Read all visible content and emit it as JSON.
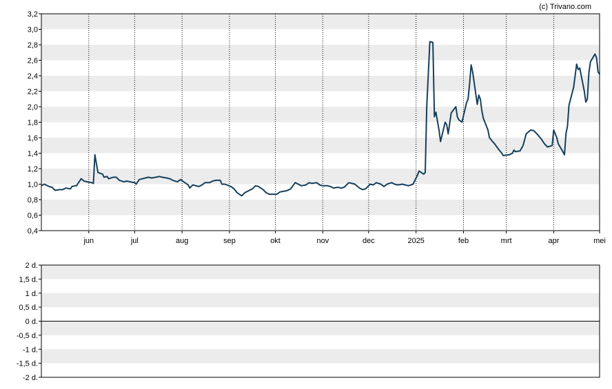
{
  "credit": "(c) Trivano.com",
  "colors": {
    "line": "#143f5c",
    "band": "#ececec",
    "axis": "#000000",
    "vgrid": "#000000",
    "zero": "#000000"
  },
  "chart_data": [
    {
      "type": "line",
      "title": "",
      "xlabel": "",
      "ylabel": "",
      "grid": "alternating horizontal bands, dotted vertical month lines",
      "ylim": [
        0.4,
        3.2
      ],
      "yticks": [
        "0,4",
        "0,6",
        "0,8",
        "1,0",
        "1,2",
        "1,4",
        "1,6",
        "1,8",
        "2,0",
        "2,2",
        "2,4",
        "2,6",
        "2,8",
        "3,0",
        "3,2"
      ],
      "xlim": [
        "2024-05-01",
        "2025-05-01"
      ],
      "xticks": [
        {
          "date": "2024-06-01",
          "label": "jun"
        },
        {
          "date": "2024-07-01",
          "label": "jul"
        },
        {
          "date": "2024-08-01",
          "label": "aug"
        },
        {
          "date": "2024-09-01",
          "label": "sep"
        },
        {
          "date": "2024-10-01",
          "label": "okt"
        },
        {
          "date": "2024-11-01",
          "label": "nov"
        },
        {
          "date": "2024-12-01",
          "label": "dec"
        },
        {
          "date": "2025-01-01",
          "label": "2025"
        },
        {
          "date": "2025-02-01",
          "label": "feb"
        },
        {
          "date": "2025-03-01",
          "label": "mrt"
        },
        {
          "date": "2025-04-01",
          "label": "apr"
        },
        {
          "date": "2025-05-01",
          "label": "mei"
        }
      ],
      "series": [
        {
          "points": [
            [
              "2024-05-01",
              0.98
            ],
            [
              "2024-05-03",
              1.0
            ],
            [
              "2024-05-06",
              0.97
            ],
            [
              "2024-05-08",
              0.96
            ],
            [
              "2024-05-10",
              0.92
            ],
            [
              "2024-05-13",
              0.93
            ],
            [
              "2024-05-15",
              0.93
            ],
            [
              "2024-05-17",
              0.95
            ],
            [
              "2024-05-20",
              0.94
            ],
            [
              "2024-05-21",
              0.97
            ],
            [
              "2024-05-23",
              0.98
            ],
            [
              "2024-05-24",
              0.98
            ],
            [
              "2024-05-27",
              1.07
            ],
            [
              "2024-05-29",
              1.04
            ],
            [
              "2024-05-31",
              1.03
            ],
            [
              "2024-06-03",
              1.02
            ],
            [
              "2024-06-04",
              1.01
            ],
            [
              "2024-06-05",
              1.38
            ],
            [
              "2024-06-07",
              1.15
            ],
            [
              "2024-06-10",
              1.13
            ],
            [
              "2024-06-11",
              1.09
            ],
            [
              "2024-06-13",
              1.1
            ],
            [
              "2024-06-14",
              1.07
            ],
            [
              "2024-06-17",
              1.09
            ],
            [
              "2024-06-19",
              1.09
            ],
            [
              "2024-06-21",
              1.05
            ],
            [
              "2024-06-24",
              1.03
            ],
            [
              "2024-06-26",
              1.04
            ],
            [
              "2024-06-28",
              1.03
            ],
            [
              "2024-07-01",
              1.02
            ],
            [
              "2024-07-02",
              1.0
            ],
            [
              "2024-07-04",
              1.06
            ],
            [
              "2024-07-08",
              1.08
            ],
            [
              "2024-07-10",
              1.09
            ],
            [
              "2024-07-12",
              1.08
            ],
            [
              "2024-07-15",
              1.09
            ],
            [
              "2024-07-17",
              1.1
            ],
            [
              "2024-07-19",
              1.09
            ],
            [
              "2024-07-22",
              1.08
            ],
            [
              "2024-07-24",
              1.07
            ],
            [
              "2024-07-26",
              1.05
            ],
            [
              "2024-07-29",
              1.03
            ],
            [
              "2024-07-31",
              1.06
            ],
            [
              "2024-08-02",
              1.03
            ],
            [
              "2024-08-05",
              0.99
            ],
            [
              "2024-08-06",
              0.95
            ],
            [
              "2024-08-08",
              0.99
            ],
            [
              "2024-08-12",
              0.97
            ],
            [
              "2024-08-14",
              0.99
            ],
            [
              "2024-08-16",
              1.02
            ],
            [
              "2024-08-19",
              1.02
            ],
            [
              "2024-08-21",
              1.04
            ],
            [
              "2024-08-23",
              1.05
            ],
            [
              "2024-08-26",
              1.05
            ],
            [
              "2024-08-27",
              1.0
            ],
            [
              "2024-08-29",
              1.0
            ],
            [
              "2024-09-02",
              0.97
            ],
            [
              "2024-09-04",
              0.94
            ],
            [
              "2024-09-06",
              0.89
            ],
            [
              "2024-09-09",
              0.85
            ],
            [
              "2024-09-11",
              0.89
            ],
            [
              "2024-09-13",
              0.91
            ],
            [
              "2024-09-16",
              0.94
            ],
            [
              "2024-09-18",
              0.98
            ],
            [
              "2024-09-20",
              0.97
            ],
            [
              "2024-09-23",
              0.93
            ],
            [
              "2024-09-25",
              0.89
            ],
            [
              "2024-09-27",
              0.87
            ],
            [
              "2024-09-30",
              0.87
            ],
            [
              "2024-10-02",
              0.87
            ],
            [
              "2024-10-04",
              0.9
            ],
            [
              "2024-10-07",
              0.91
            ],
            [
              "2024-10-09",
              0.92
            ],
            [
              "2024-10-11",
              0.94
            ],
            [
              "2024-10-14",
              1.02
            ],
            [
              "2024-10-16",
              1.0
            ],
            [
              "2024-10-18",
              0.98
            ],
            [
              "2024-10-21",
              0.99
            ],
            [
              "2024-10-23",
              1.02
            ],
            [
              "2024-10-25",
              1.01
            ],
            [
              "2024-10-28",
              1.02
            ],
            [
              "2024-10-30",
              0.99
            ],
            [
              "2024-11-01",
              0.98
            ],
            [
              "2024-11-04",
              0.98
            ],
            [
              "2024-11-06",
              0.97
            ],
            [
              "2024-11-08",
              0.95
            ],
            [
              "2024-11-11",
              0.96
            ],
            [
              "2024-11-13",
              0.95
            ],
            [
              "2024-11-15",
              0.96
            ],
            [
              "2024-11-18",
              1.02
            ],
            [
              "2024-11-20",
              1.01
            ],
            [
              "2024-11-22",
              1.0
            ],
            [
              "2024-11-25",
              0.95
            ],
            [
              "2024-11-27",
              0.93
            ],
            [
              "2024-11-29",
              0.94
            ],
            [
              "2024-12-02",
              1.0
            ],
            [
              "2024-12-04",
              0.99
            ],
            [
              "2024-12-06",
              1.02
            ],
            [
              "2024-12-09",
              1.0
            ],
            [
              "2024-12-11",
              0.97
            ],
            [
              "2024-12-13",
              1.0
            ],
            [
              "2024-12-16",
              1.02
            ],
            [
              "2024-12-18",
              1.0
            ],
            [
              "2024-12-20",
              0.99
            ],
            [
              "2024-12-23",
              1.0
            ],
            [
              "2024-12-27",
              0.98
            ],
            [
              "2024-12-30",
              1.0
            ],
            [
              "2025-01-02",
              1.12
            ],
            [
              "2025-01-03",
              1.17
            ],
            [
              "2025-01-06",
              1.13
            ],
            [
              "2025-01-07",
              1.15
            ],
            [
              "2025-01-08",
              2.0
            ],
            [
              "2025-01-10",
              2.84
            ],
            [
              "2025-01-12",
              2.83
            ],
            [
              "2025-01-13",
              1.87
            ],
            [
              "2025-01-14",
              1.93
            ],
            [
              "2025-01-16",
              1.7
            ],
            [
              "2025-01-17",
              1.55
            ],
            [
              "2025-01-20",
              1.8
            ],
            [
              "2025-01-21",
              1.77
            ],
            [
              "2025-01-22",
              1.65
            ],
            [
              "2025-01-24",
              1.92
            ],
            [
              "2025-01-27",
              2.0
            ],
            [
              "2025-01-28",
              1.87
            ],
            [
              "2025-01-29",
              1.83
            ],
            [
              "2025-01-31",
              1.8
            ],
            [
              "2025-02-03",
              2.05
            ],
            [
              "2025-02-04",
              2.1
            ],
            [
              "2025-02-05",
              2.3
            ],
            [
              "2025-02-06",
              2.54
            ],
            [
              "2025-02-07",
              2.45
            ],
            [
              "2025-02-10",
              2.03
            ],
            [
              "2025-02-11",
              2.15
            ],
            [
              "2025-02-12",
              2.1
            ],
            [
              "2025-02-13",
              1.95
            ],
            [
              "2025-02-14",
              1.85
            ],
            [
              "2025-02-17",
              1.7
            ],
            [
              "2025-02-18",
              1.6
            ],
            [
              "2025-02-20",
              1.55
            ],
            [
              "2025-02-21",
              1.53
            ],
            [
              "2025-02-24",
              1.45
            ],
            [
              "2025-02-26",
              1.4
            ],
            [
              "2025-02-27",
              1.37
            ],
            [
              "2025-03-03",
              1.38
            ],
            [
              "2025-03-05",
              1.4
            ],
            [
              "2025-03-06",
              1.44
            ],
            [
              "2025-03-07",
              1.42
            ],
            [
              "2025-03-10",
              1.43
            ],
            [
              "2025-03-12",
              1.5
            ],
            [
              "2025-03-14",
              1.65
            ],
            [
              "2025-03-17",
              1.7
            ],
            [
              "2025-03-19",
              1.69
            ],
            [
              "2025-03-21",
              1.65
            ],
            [
              "2025-03-24",
              1.58
            ],
            [
              "2025-03-26",
              1.52
            ],
            [
              "2025-03-28",
              1.48
            ],
            [
              "2025-03-31",
              1.5
            ],
            [
              "2025-04-01",
              1.7
            ],
            [
              "2025-04-03",
              1.6
            ],
            [
              "2025-04-04",
              1.52
            ],
            [
              "2025-04-07",
              1.42
            ],
            [
              "2025-04-08",
              1.38
            ],
            [
              "2025-04-09",
              1.65
            ],
            [
              "2025-04-10",
              1.75
            ],
            [
              "2025-04-11",
              2.02
            ],
            [
              "2025-04-14",
              2.25
            ],
            [
              "2025-04-15",
              2.4
            ],
            [
              "2025-04-16",
              2.55
            ],
            [
              "2025-04-17",
              2.48
            ],
            [
              "2025-04-18",
              2.5
            ],
            [
              "2025-04-21",
              2.2
            ],
            [
              "2025-04-22",
              2.06
            ],
            [
              "2025-04-23",
              2.1
            ],
            [
              "2025-04-24",
              2.44
            ],
            [
              "2025-04-25",
              2.58
            ],
            [
              "2025-04-28",
              2.68
            ],
            [
              "2025-04-29",
              2.63
            ],
            [
              "2025-04-30",
              2.45
            ],
            [
              "2025-05-01",
              2.42
            ]
          ]
        }
      ]
    },
    {
      "type": "line",
      "title": "",
      "xlabel": "",
      "ylabel": "",
      "grid": "alternating horizontal bands",
      "ylim": [
        -2,
        2
      ],
      "yticks": [
        "-2 d.",
        "-1,5 d.",
        "-1 d.",
        "-0,5 d.",
        "0 d.",
        "0,5 d.",
        "1 d.",
        "1,5 d.",
        "2 d."
      ],
      "series": []
    }
  ]
}
